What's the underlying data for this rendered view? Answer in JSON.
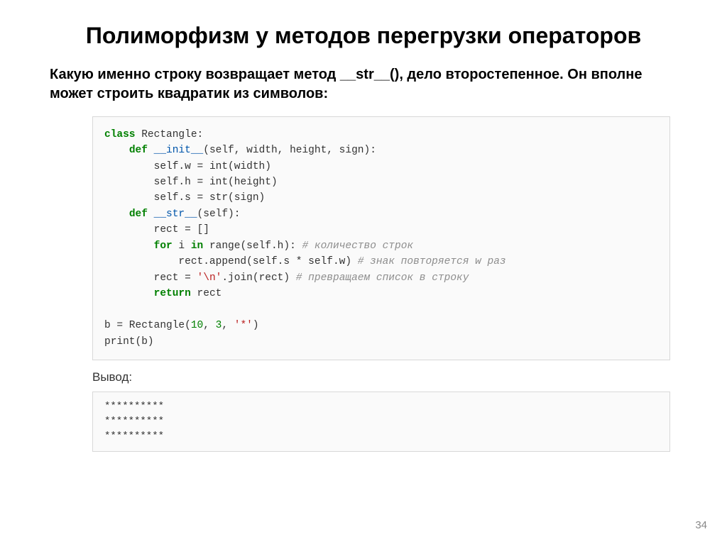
{
  "title": "Полиморфизм у методов перегрузки операторов",
  "body_text": "Какую именно строку возвращает метод __str__(), дело второстепенное. Он вполне может строить квадратик из символов:",
  "code": {
    "l0_kw_class": "class",
    "l0_name": " Rectangle:",
    "l1_kw_def": "def",
    "l1_name": " __init__",
    "l1_params": "(self, width, height, sign):",
    "l2": "self.w = int(width)",
    "l3": "self.h = int(height)",
    "l4": "self.s = str(sign)",
    "l5_kw_def": "def",
    "l5_name": " __str__",
    "l5_params": "(self):",
    "l6": "rect = []",
    "l7_kw_for": "for",
    "l7_mid": " i ",
    "l7_kw_in": "in",
    "l7_rest": " range(self.h): ",
    "l7_cmt": "# количество строк",
    "l8_body": "rect.append(self.s * self.w) ",
    "l8_cmt": "# знак повторяется w раз",
    "l9_left": "rect = ",
    "l9_str": "'\\n'",
    "l9_right": ".join(rect) ",
    "l9_cmt": "# превращаем список в строку",
    "l10_kw": "return",
    "l10_rest": " rect",
    "l12_left": "b = Rectangle(",
    "l12_n1": "10",
    "l12_c1": ", ",
    "l12_n2": "3",
    "l12_c2": ", ",
    "l12_str": "'*'",
    "l12_end": ")",
    "l13": "print(b)"
  },
  "output_label": "Вывод:",
  "output": "**********\n**********\n**********",
  "page_num": "34"
}
